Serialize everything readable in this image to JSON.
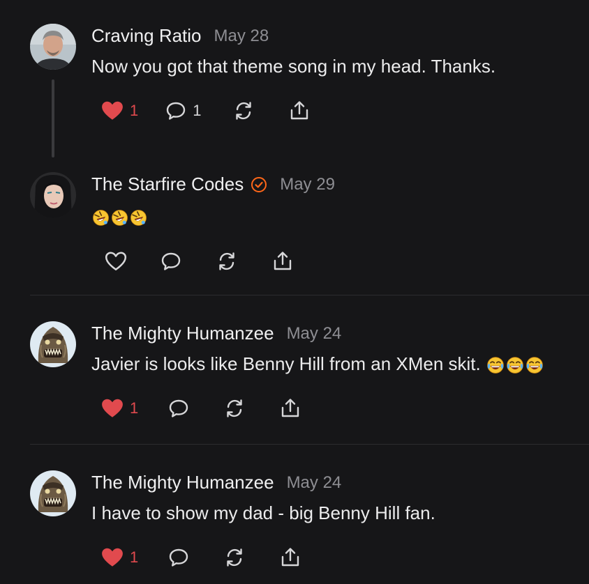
{
  "comments": [
    {
      "author": "Craving Ratio",
      "date": "May 28",
      "text": "Now you got that theme song in my head. Thanks.",
      "liked": true,
      "like_count": "1",
      "reply_count": "1",
      "avatar_icon": "man-portrait-avatar"
    },
    {
      "author": "The Starfire Codes",
      "verified": true,
      "date": "May 29",
      "text": "",
      "emoji": [
        "rolling-on-floor-laughing",
        "rolling-on-floor-laughing",
        "rolling-on-floor-laughing"
      ],
      "liked": false,
      "like_count": "",
      "reply_count": "",
      "avatar_icon": "woman-portrait-avatar"
    },
    {
      "author": "The Mighty Humanzee",
      "date": "May 24",
      "text": "Javier is looks like Benny Hill from an XMen skit. ",
      "emoji": [
        "tears-of-joy",
        "tears-of-joy",
        "tears-of-joy"
      ],
      "liked": true,
      "like_count": "1",
      "reply_count": "",
      "avatar_icon": "creature-mask-avatar"
    },
    {
      "author": "The Mighty Humanzee",
      "date": "May 24",
      "text": "I have to show my dad - big Benny Hill fan.",
      "liked": true,
      "like_count": "1",
      "reply_count": "",
      "avatar_icon": "creature-mask-avatar"
    }
  ],
  "colors": {
    "background": "#161618",
    "like_red": "#e14a4e",
    "verified_orange": "#ff6719",
    "muted": "#8e8e93"
  }
}
